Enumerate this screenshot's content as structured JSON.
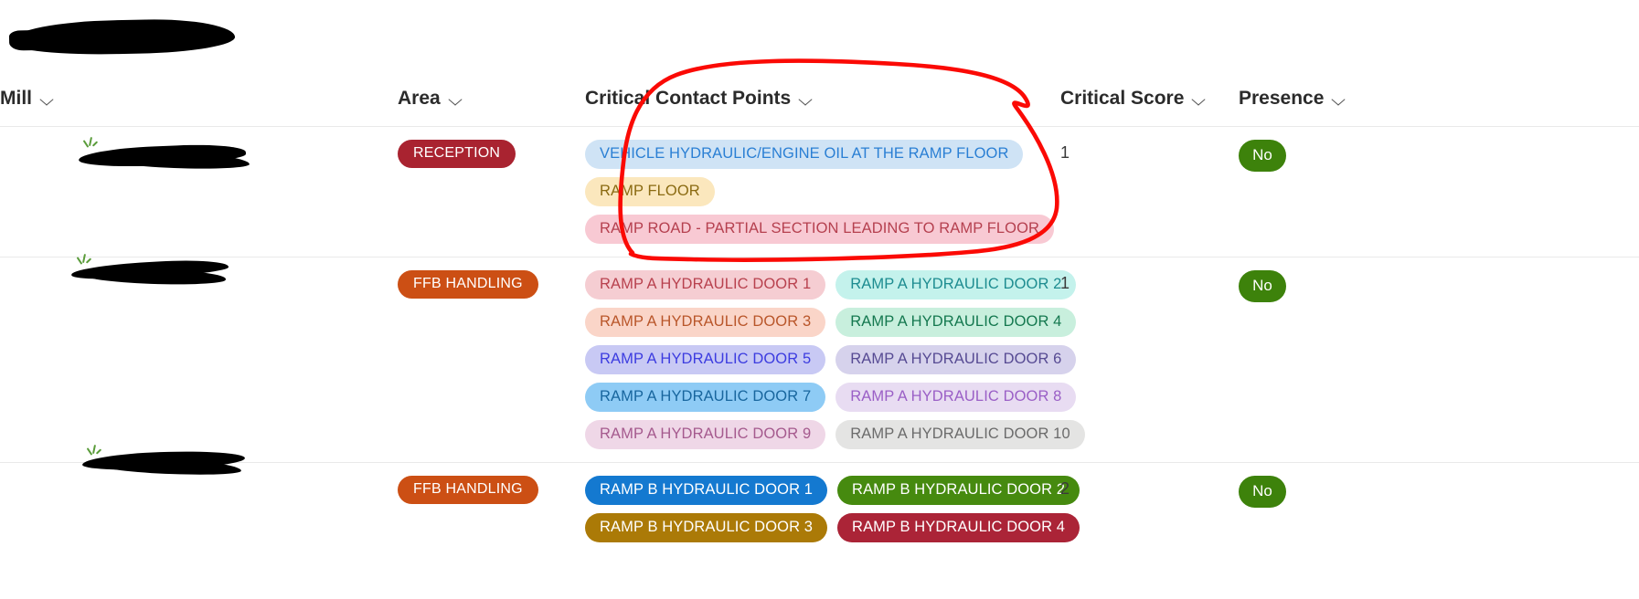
{
  "table": {
    "columns": [
      {
        "id": "mill",
        "label": "Mill",
        "sort_icon": "chevron-down-icon"
      },
      {
        "id": "area",
        "label": "Area",
        "sort_icon": "chevron-down-icon"
      },
      {
        "id": "ccp",
        "label": "Critical Contact Points",
        "sort_icon": "chevron-down-icon"
      },
      {
        "id": "score",
        "label": "Critical Score",
        "sort_icon": "chevron-down-icon"
      },
      {
        "id": "pres",
        "label": "Presence",
        "sort_icon": "chevron-down-icon"
      }
    ],
    "rows": [
      {
        "mill": "",
        "mill_redacted": true,
        "area": "RECEPTION",
        "area_bg": "#a92330",
        "area_fg": "#ffffff",
        "critical_score": "1",
        "presence": "No",
        "presence_bg": "#3d820b",
        "presence_fg": "#ffffff",
        "tag_rows": [
          [
            {
              "label": "VEHICLE HYDRAULIC/ENGINE OIL AT THE RAMP FLOOR",
              "bg": "#cfe3f5",
              "fg": "#2a7fd4"
            }
          ],
          [
            {
              "label": "RAMP FLOOR",
              "bg": "#fbe7bd",
              "fg": "#8a6a11"
            }
          ],
          [
            {
              "label": "RAMP ROAD - PARTIAL SECTION LEADING TO RAMP FLOOR",
              "bg": "#f8c9d3",
              "fg": "#b5404f"
            }
          ]
        ]
      },
      {
        "mill": "",
        "mill_redacted": true,
        "area": "FFB HANDLING",
        "area_bg": "#cc4f14",
        "area_fg": "#ffffff",
        "critical_score": "1",
        "presence": "No",
        "presence_bg": "#3d820b",
        "presence_fg": "#ffffff",
        "tag_rows": [
          [
            {
              "label": "RAMP A HYDRAULIC DOOR 1",
              "bg": "#f5cdd2",
              "fg": "#b8414e"
            },
            {
              "label": "RAMP A HYDRAULIC DOOR 2",
              "bg": "#c4f2ec",
              "fg": "#1d8c90"
            }
          ],
          [
            {
              "label": "RAMP A HYDRAULIC DOOR 3",
              "bg": "#fad5c8",
              "fg": "#b9562a"
            },
            {
              "label": "RAMP A HYDRAULIC DOOR 4",
              "bg": "#c8efdd",
              "fg": "#14784f"
            }
          ],
          [
            {
              "label": "RAMP A HYDRAULIC DOOR 5",
              "bg": "#c8c9f4",
              "fg": "#3c3ce0"
            },
            {
              "label": "RAMP A HYDRAULIC DOOR 6",
              "bg": "#d6d2ec",
              "fg": "#564a93"
            }
          ],
          [
            {
              "label": "RAMP A HYDRAULIC DOOR 7",
              "bg": "#8ecbf5",
              "fg": "#18669e"
            },
            {
              "label": "RAMP A HYDRAULIC DOOR 8",
              "bg": "#e8dcf2",
              "fg": "#9a5fc6"
            }
          ],
          [
            {
              "label": "RAMP A HYDRAULIC DOOR 9",
              "bg": "#efd7e7",
              "fg": "#a55a8e"
            },
            {
              "label": "RAMP A HYDRAULIC DOOR 10",
              "bg": "#e4e4e3",
              "fg": "#6b6b6b"
            }
          ]
        ]
      },
      {
        "mill": "",
        "mill_redacted": true,
        "area": "FFB HANDLING",
        "area_bg": "#cc4f14",
        "area_fg": "#ffffff",
        "critical_score": "2",
        "presence": "No",
        "presence_bg": "#3d820b",
        "presence_fg": "#ffffff",
        "tag_rows": [
          [
            {
              "label": "RAMP B HYDRAULIC DOOR 1",
              "bg": "#1479d0",
              "fg": "#ffffff"
            },
            {
              "label": "RAMP B HYDRAULIC DOOR 2",
              "bg": "#468a0f",
              "fg": "#ffffff"
            }
          ],
          [
            {
              "label": "RAMP B HYDRAULIC DOOR 3",
              "bg": "#ab7a07",
              "fg": "#ffffff"
            },
            {
              "label": "RAMP B HYDRAULIC DOOR 4",
              "bg": "#ab2437",
              "fg": "#ffffff"
            }
          ]
        ]
      }
    ]
  },
  "annotation": {
    "type": "hand-drawn-ellipse",
    "color": "#fb0a05",
    "targets": "Critical Contact Points column header and first row tags"
  }
}
